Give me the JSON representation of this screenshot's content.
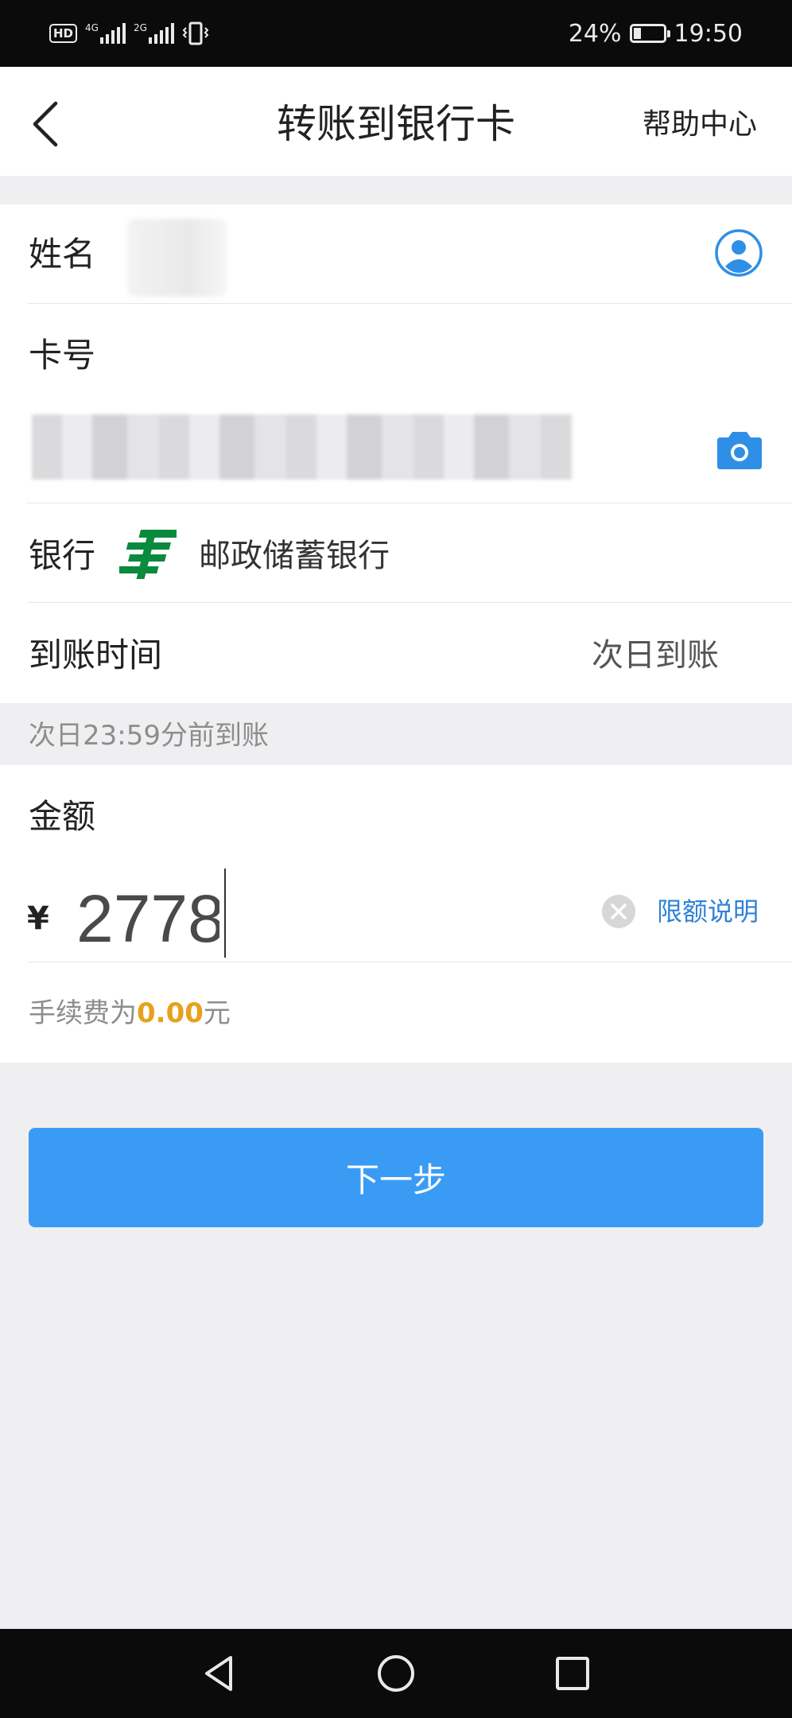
{
  "status_bar": {
    "hd": "HD",
    "net1": "4G",
    "net2": "2G",
    "battery": "24%",
    "battery_level": 0.24,
    "time": "19:50"
  },
  "nav": {
    "title": "转账到银行卡",
    "help": "帮助中心",
    "back_icon": "chevron-left-icon"
  },
  "form": {
    "name_label": "姓名",
    "contact_icon": "contact-person-icon",
    "card_label": "卡号",
    "camera_icon": "camera-icon",
    "bank_label": "银行",
    "bank_name": "邮政储蓄银行",
    "bank_logo_icon": "postal-savings-bank-logo",
    "eta_label": "到账时间",
    "eta_value": "次日到账",
    "eta_note": "次日23:59分前到账"
  },
  "amount": {
    "label": "金额",
    "currency": "¥",
    "value": "2778",
    "clear_icon": "clear-icon",
    "limit_link": "限额说明",
    "fee_prefix": "手续费为",
    "fee_value": "0.00",
    "fee_suffix": "元"
  },
  "actions": {
    "next": "下一步"
  },
  "system_nav": {
    "back": "triangle-back-icon",
    "home": "circle-home-icon",
    "recents": "square-recents-icon"
  },
  "colors": {
    "primary": "#3a9bf5",
    "link": "#2f82d8",
    "fee": "#e8a01d",
    "icon_blue": "#2f8fe6"
  }
}
